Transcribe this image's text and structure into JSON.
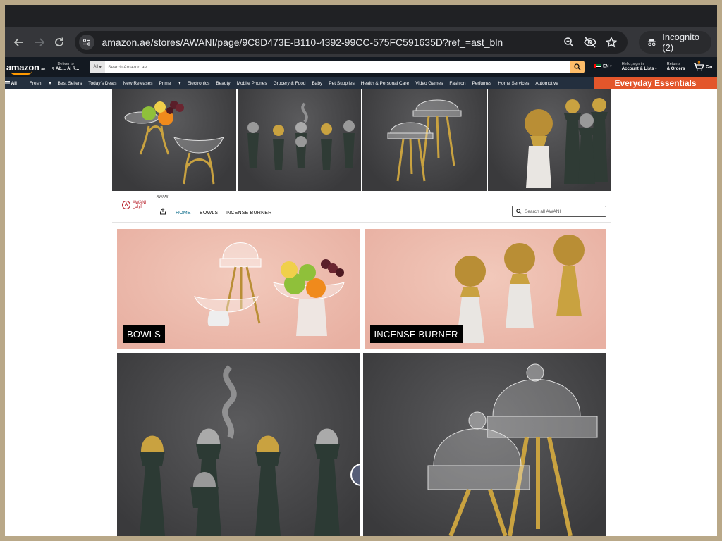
{
  "browser": {
    "url": "amazon.ae/stores/AWANI/page/9C8D473E-B110-4392-99CC-575FC591635D?ref_=ast_bln",
    "incognito_label": "Incognito (2)"
  },
  "amazon": {
    "logo": "amazon",
    "logo_tld": ".ae",
    "deliver_line1": "Deliver to",
    "deliver_line2": "Ab..., Al R...",
    "search_category": "All",
    "search_placeholder": "Search Amazon.ae",
    "language": "EN",
    "account_line1": "Hello, sign in",
    "account_line2": "Account & Lists",
    "orders_line1": "Returns",
    "orders_line2": "& Orders",
    "cart_count": "0",
    "cart_label": "Car",
    "nav": [
      "All",
      "Fresh",
      "Best Sellers",
      "Today's Deals",
      "New Releases",
      "Prime",
      "Electronics",
      "Beauty",
      "Mobile Phones",
      "Grocery & Food",
      "Baby",
      "Pet Supplies",
      "Health & Personal Care",
      "Video Games",
      "Fashion",
      "Perfumes",
      "Home Services",
      "Automotive"
    ],
    "promo": "Everyday Essentials"
  },
  "store": {
    "brand_small": "AWANI",
    "brand_arabic": "أواني",
    "brand_latin": "AWANI",
    "links": [
      "HOME",
      "BOWLS",
      "INCENSE BURNER"
    ],
    "search_placeholder": "Search all AWANI",
    "categories": [
      "BOWLS",
      "INCENSE BURNER"
    ]
  },
  "colors": {
    "amazon_dark": "#131921",
    "amazon_nav": "#232f3e",
    "promo_bg": "#e3562b",
    "search_button": "#febd69",
    "active_link": "#0f6e8c",
    "tile_pink": "#eebdb0",
    "tile_dark": "#444446"
  },
  "icons": [
    "back-arrow-icon",
    "forward-arrow-icon",
    "reload-icon",
    "site-info-icon",
    "zoom-icon",
    "eye-off-icon",
    "star-icon",
    "incognito-icon",
    "location-pin-icon",
    "search-icon",
    "cart-icon",
    "menu-icon",
    "share-icon",
    "play-icon"
  ]
}
